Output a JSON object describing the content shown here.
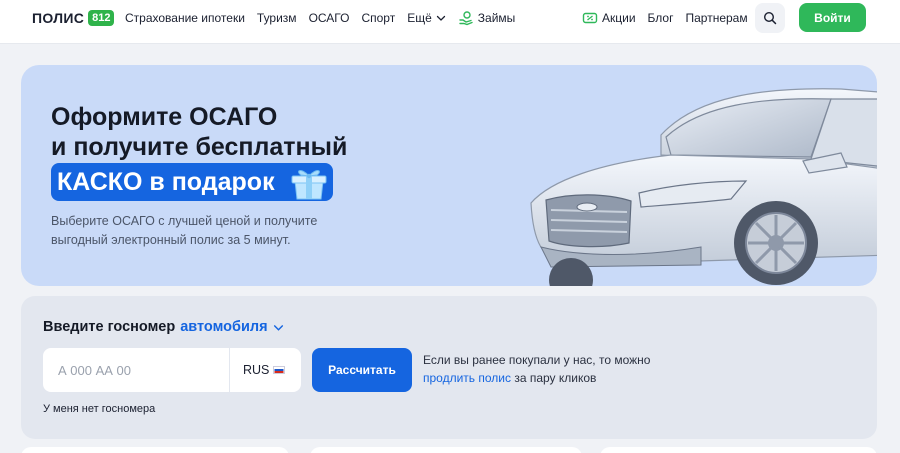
{
  "header": {
    "logo_text": "ПОЛИС",
    "logo_badge": "812",
    "nav_left": [
      {
        "label": "Страхование ипотеки"
      },
      {
        "label": "Туризм"
      },
      {
        "label": "ОСАГО"
      },
      {
        "label": "Спорт"
      },
      {
        "label": "Ещё"
      }
    ],
    "loans_label": "Займы",
    "promo_label": "Акции",
    "blog_label": "Блог",
    "partners_label": "Партнерам",
    "login_label": "Войти"
  },
  "hero": {
    "title_line1": "Оформите ОСАГО",
    "title_line2": "и получите бесплатный",
    "highlight": "КАСКО в подарок",
    "subtitle": "Выберите ОСАГО с лучшей ценой и получите выгодный электронный полис за 5 минут."
  },
  "form": {
    "title_prefix": "Введите госномер",
    "title_accent": "автомобиля",
    "plate_placeholder": "А 000 АА 00",
    "region_label": "RUS",
    "calc_label": "Рассчитать",
    "hint_text_before": "Если вы ранее покупали у нас, то можно",
    "hint_link": "продлить полис",
    "hint_text_after": "за пару кликов",
    "no_plate_label": "У меня нет госномера"
  },
  "colors": {
    "brand_green": "#2fb85a",
    "accent_blue": "#1565e0",
    "hero_bg": "#c9daf8"
  },
  "icons": [
    "chevron-down-icon",
    "loans-hand-icon",
    "promo-ticket-icon",
    "search-icon",
    "gift-icon",
    "russia-flag-icon"
  ]
}
